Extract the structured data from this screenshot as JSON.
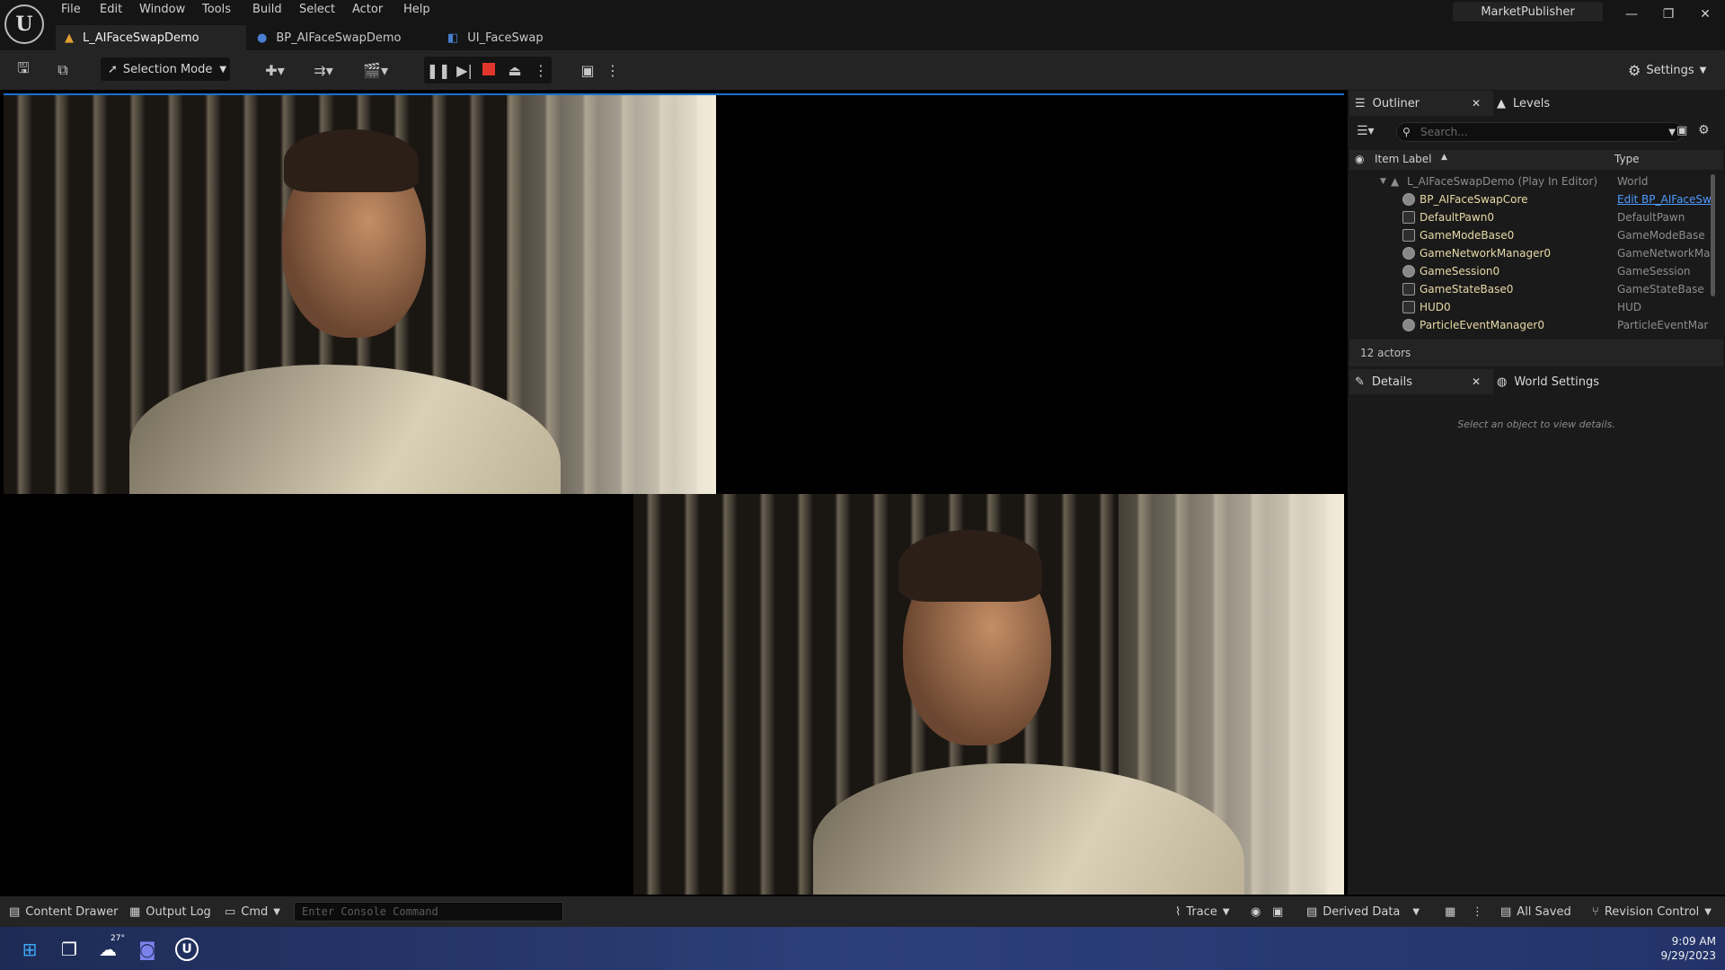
{
  "menu": [
    "File",
    "Edit",
    "Window",
    "Tools",
    "Build",
    "Select",
    "Actor",
    "Help"
  ],
  "tabs": [
    {
      "label": "L_AIFaceSwapDemo",
      "icon": "level-icon",
      "active": true
    },
    {
      "label": "BP_AIFaceSwapDemo",
      "icon": "blueprint-icon",
      "active": false
    },
    {
      "label": "UI_FaceSwap",
      "icon": "widget-icon",
      "active": false
    }
  ],
  "publisher": "MarketPublisher",
  "toolbar": {
    "selection_mode": "Selection Mode",
    "settings": "Settings"
  },
  "outliner": {
    "tab_outliner": "Outliner",
    "tab_levels": "Levels",
    "search_placeholder": "Search...",
    "col_item": "Item Label",
    "col_type": "Type",
    "world_row": {
      "label": "L_AIFaceSwapDemo (Play In Editor)",
      "type": "World"
    },
    "rows": [
      {
        "label": "BP_AIFaceSwapCore",
        "type": "Edit BP_AIFaceSw"
      },
      {
        "label": "DefaultPawn0",
        "type": "DefaultPawn"
      },
      {
        "label": "GameModeBase0",
        "type": "GameModeBase"
      },
      {
        "label": "GameNetworkManager0",
        "type": "GameNetworkMa"
      },
      {
        "label": "GameSession0",
        "type": "GameSession"
      },
      {
        "label": "GameStateBase0",
        "type": "GameStateBase"
      },
      {
        "label": "HUD0",
        "type": "HUD"
      },
      {
        "label": "ParticleEventManager0",
        "type": "ParticleEventMar"
      }
    ],
    "actor_count": "12 actors"
  },
  "details": {
    "tab_details": "Details",
    "tab_world": "World Settings",
    "empty_msg": "Select an object to view details."
  },
  "statusbar": {
    "content_drawer": "Content Drawer",
    "output_log": "Output Log",
    "cmd": "Cmd",
    "console_placeholder": "Enter Console Command",
    "trace": "Trace",
    "derived_data": "Derived Data",
    "all_saved": "All Saved",
    "revision_control": "Revision Control"
  },
  "taskbar": {
    "weather": "27°",
    "time": "9:09 AM",
    "date": "9/29/2023"
  },
  "colors": {
    "accent": "#1e6fcf",
    "stop_red": "#e0362c",
    "actor_label": "#e8d9a7"
  }
}
